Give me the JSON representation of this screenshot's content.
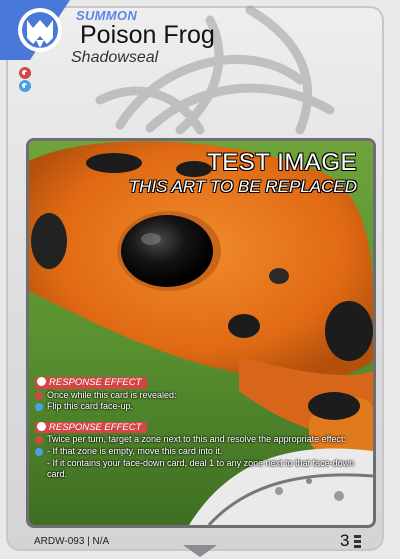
{
  "card": {
    "type_label": "SUMMON",
    "name": "Poison Frog",
    "subtype": "Shadowseal",
    "cost_gems": [
      "red",
      "blue"
    ],
    "art": {
      "title": "TEST IMAGE",
      "subtitle": "THIS ART TO BE REPLACED"
    },
    "effects": [
      {
        "heading": "RESPONSE EFFECT",
        "lines": [
          {
            "marker": "red",
            "text": "Once while this card is revealed:"
          },
          {
            "marker": "blue",
            "text": "Flip this card face-up."
          }
        ]
      },
      {
        "heading": "RESPONSE EFFECT",
        "lines": [
          {
            "marker": "red",
            "text": "Twice per turn, target a zone next to this and resolve the appropriate effect:"
          },
          {
            "marker": "blue",
            "text": "- If that zone is empty, move this card into it."
          },
          {
            "marker": "",
            "text": "- If it contains your face-down card, deal 1 to any zone next to that face-down card."
          }
        ]
      }
    ],
    "footer": {
      "code": "ARDW-093 | N/A",
      "number": "3"
    },
    "colors": {
      "accent_blue": "#5f86e6",
      "effect_red": "#d24646",
      "frog_orange": "#e8781c"
    }
  }
}
